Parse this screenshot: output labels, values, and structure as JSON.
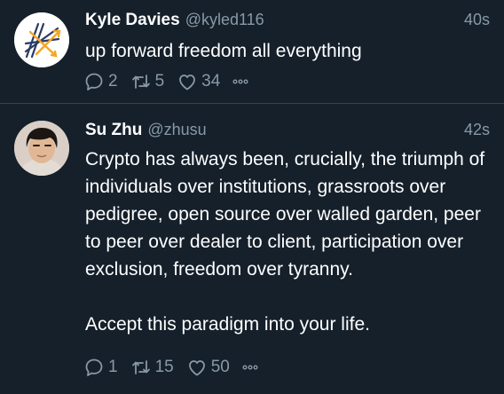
{
  "tweets": [
    {
      "name": "Kyle Davies",
      "handle": "@kyled116",
      "time": "40s",
      "text": "up forward freedom all everything",
      "replies": "2",
      "retweets": "5",
      "likes": "34"
    },
    {
      "name": "Su Zhu",
      "handle": "@zhusu",
      "time": "42s",
      "text": "Crypto has always been, crucially, the triumph of individuals over institutions, grassroots over pedigree, open source over walled garden, peer to peer over dealer to client, participation over exclusion, freedom over tyranny.\n\nAccept this paradigm into your life.",
      "replies": "1",
      "retweets": "15",
      "likes": "50"
    }
  ],
  "colors": {
    "background": "#15202b",
    "muted": "#8899a6",
    "divider": "#38444d"
  },
  "icons": {
    "reply": "reply-icon",
    "retweet": "retweet-icon",
    "like": "like-icon",
    "more": "more-icon"
  }
}
